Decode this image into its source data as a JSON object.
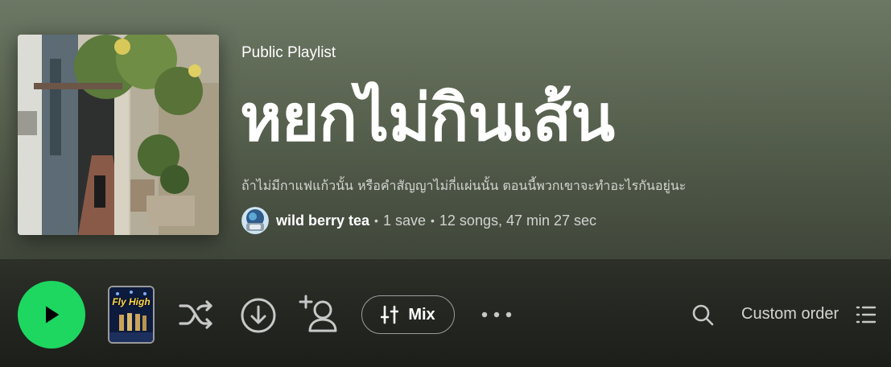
{
  "playlist": {
    "type_label": "Public Playlist",
    "title": "หยกไม่กินเส้น",
    "description": "ถ้าไม่มีกาแฟแก้วนั้น หรือคำสัญญาไม่กี่แผ่นนั้น ตอนนี้พวกเขาจะทำอะไรกันอยู่นะ",
    "owner": "wild berry tea",
    "saves": "1 save",
    "stats": "12 songs, 47 min 27 sec",
    "separator": "•"
  },
  "actions": {
    "play_icon": "play-icon",
    "now_playing_cover_title": "Fly High",
    "shuffle_icon": "shuffle-icon",
    "download_icon": "download-circle-icon",
    "follow_icon": "add-user-icon",
    "mix_label": "Mix",
    "mix_icon": "sliders-icon",
    "more_icon": "more-horizontal-icon",
    "search_icon": "search-icon",
    "sort_label": "Custom order",
    "list_icon": "list-icon"
  },
  "colors": {
    "accent_green": "#1ed760",
    "hero_top": "#6c7764",
    "hero_bottom": "#3f463a",
    "bar_bg": "#1c1e1a"
  }
}
